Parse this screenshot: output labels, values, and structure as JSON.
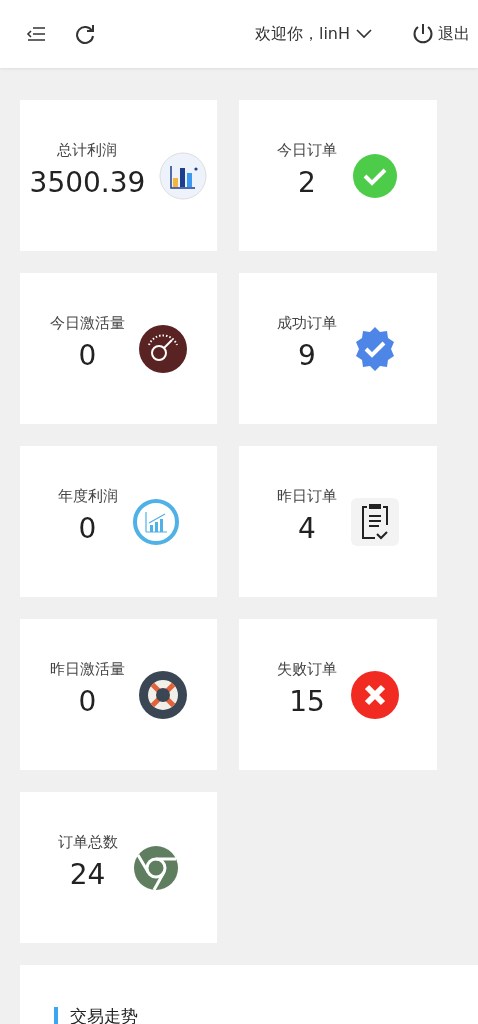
{
  "header": {
    "greeting": "欢迎你，linH",
    "logout": "退出"
  },
  "cards": [
    {
      "label": "总计利润",
      "value": "3500.39"
    },
    {
      "label": "今日订单",
      "value": "2"
    },
    {
      "label": "今日激活量",
      "value": "0"
    },
    {
      "label": "成功订单",
      "value": "9"
    },
    {
      "label": "年度利润",
      "value": "0"
    },
    {
      "label": "昨日订单",
      "value": "4"
    },
    {
      "label": "昨日激活量",
      "value": "0"
    },
    {
      "label": "失败订单",
      "value": "15"
    },
    {
      "label": "订单总数",
      "value": "24"
    }
  ],
  "trend_panel": {
    "title": "交易走势"
  }
}
